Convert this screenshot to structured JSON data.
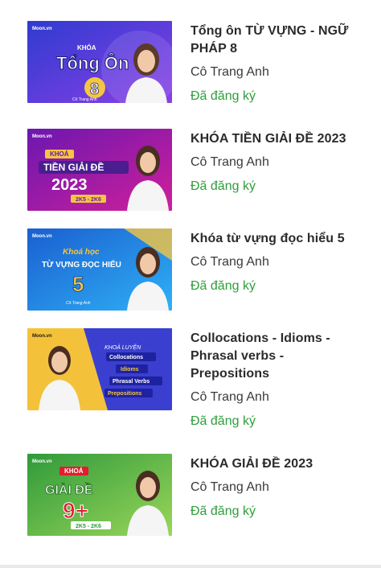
{
  "courses": [
    {
      "title": "Tổng ôn TỪ VỰNG - NGỮ PHÁP 8",
      "teacher": "Cô Trang Anh",
      "status": "Đã đăng ký",
      "thumb": {
        "brand": "Moon.vn",
        "lines": [
          "KHÓA",
          "Tổng Ôn",
          "8"
        ],
        "footer": "Cô Trang Anh",
        "colors": [
          "#3a3fcf",
          "#7b3fe0",
          "#f5c542"
        ]
      }
    },
    {
      "title": "KHÓA TIỀN GIẢI ĐỀ 2023",
      "teacher": "Cô Trang Anh",
      "status": "Đã đăng ký",
      "thumb": {
        "brand": "Moon.vn",
        "lines": [
          "KHOÁ",
          "TIỀN GIẢI ĐỀ",
          "2023"
        ],
        "footer": "2K5 - 2K6",
        "colors": [
          "#7a1fb6",
          "#c21f9a",
          "#f5c542"
        ]
      }
    },
    {
      "title": "Khóa từ vựng đọc hiểu 5",
      "teacher": "Cô Trang Anh",
      "status": "Đã đăng ký",
      "thumb": {
        "brand": "Moon.vn",
        "lines": [
          "Khoá học",
          "TỪ VỰNG ĐỌC HIỂU",
          "5"
        ],
        "footer": "Cô Trang Anh",
        "colors": [
          "#1f6fd8",
          "#2aa6f0",
          "#f5c542"
        ]
      }
    },
    {
      "title": "Collocations - Idioms - Phrasal verbs - Prepositions",
      "teacher": "Cô Trang Anh",
      "status": "Đã đăng ký",
      "thumb": {
        "brand": "Moon.vn",
        "lines": [
          "KHOÁ LUYỆN",
          "Collocations",
          "Idioms",
          "Phrasal Verbs",
          "Prepositions"
        ],
        "footer": "",
        "colors": [
          "#f4c23a",
          "#3b3fd0",
          "#ffffff"
        ]
      }
    },
    {
      "title": "KHÓA GIẢI ĐỀ 2023",
      "teacher": "Cô Trang Anh",
      "status": "Đã đăng ký",
      "thumb": {
        "brand": "Moon.vn",
        "lines": [
          "KHOÁ",
          "GIẢI ĐỀ",
          "9+"
        ],
        "footer": "2K5 - 2K6",
        "colors": [
          "#3aa83a",
          "#8fd14f",
          "#e11d2f"
        ]
      }
    }
  ]
}
